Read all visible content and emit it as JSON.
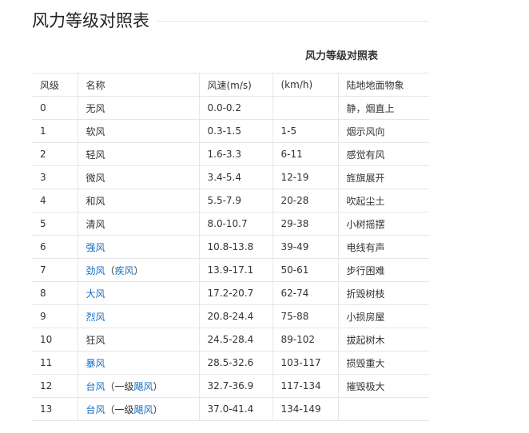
{
  "page_title": "风力等级对照表",
  "table": {
    "caption": "风力等级对照表",
    "headers": [
      "风级",
      "名称",
      "风速(m/s)",
      "(km/h)",
      "陆地地面物象"
    ],
    "rows": [
      {
        "level": "0",
        "name_parts": [
          {
            "text": "无风",
            "link": false
          }
        ],
        "ms": "0.0-0.2",
        "kmh": "",
        "land": "静，烟直上"
      },
      {
        "level": "1",
        "name_parts": [
          {
            "text": "软风",
            "link": false
          }
        ],
        "ms": "0.3-1.5",
        "kmh": "1-5",
        "land": "烟示风向"
      },
      {
        "level": "2",
        "name_parts": [
          {
            "text": "轻风",
            "link": false
          }
        ],
        "ms": "1.6-3.3",
        "kmh": "6-11",
        "land": "感觉有风"
      },
      {
        "level": "3",
        "name_parts": [
          {
            "text": "微风",
            "link": false
          }
        ],
        "ms": "3.4-5.4",
        "kmh": "12-19",
        "land": "旌旗展开"
      },
      {
        "level": "4",
        "name_parts": [
          {
            "text": "和风",
            "link": false
          }
        ],
        "ms": "5.5-7.9",
        "kmh": "20-28",
        "land": "吹起尘土"
      },
      {
        "level": "5",
        "name_parts": [
          {
            "text": "清风",
            "link": false
          }
        ],
        "ms": "8.0-10.7",
        "kmh": "29-38",
        "land": "小树摇摆"
      },
      {
        "level": "6",
        "name_parts": [
          {
            "text": "强风",
            "link": true
          }
        ],
        "ms": "10.8-13.8",
        "kmh": "39-49",
        "land": "电线有声"
      },
      {
        "level": "7",
        "name_parts": [
          {
            "text": "劲风",
            "link": true
          },
          {
            "text": "（",
            "link": false
          },
          {
            "text": "疾风",
            "link": true
          },
          {
            "text": "）",
            "link": false
          }
        ],
        "ms": "13.9-17.1",
        "kmh": "50-61",
        "land": "步行困难"
      },
      {
        "level": "8",
        "name_parts": [
          {
            "text": "大风",
            "link": true
          }
        ],
        "ms": "17.2-20.7",
        "kmh": "62-74",
        "land": "折毁树枝"
      },
      {
        "level": "9",
        "name_parts": [
          {
            "text": "烈风",
            "link": true
          }
        ],
        "ms": "20.8-24.4",
        "kmh": "75-88",
        "land": "小损房屋"
      },
      {
        "level": "10",
        "name_parts": [
          {
            "text": "狂风",
            "link": false
          }
        ],
        "ms": "24.5-28.4",
        "kmh": "89-102",
        "land": "拔起树木"
      },
      {
        "level": "11",
        "name_parts": [
          {
            "text": "暴风",
            "link": true
          }
        ],
        "ms": "28.5-32.6",
        "kmh": "103-117",
        "land": "损毁重大"
      },
      {
        "level": "12",
        "name_parts": [
          {
            "text": "台风",
            "link": true
          },
          {
            "text": "（一级",
            "link": false
          },
          {
            "text": "飓风",
            "link": true
          },
          {
            "text": "）",
            "link": false
          }
        ],
        "ms": "32.7-36.9",
        "kmh": "117-134",
        "land": "摧毁极大"
      },
      {
        "level": "13",
        "name_parts": [
          {
            "text": "台风",
            "link": true
          },
          {
            "text": "（一级",
            "link": false
          },
          {
            "text": "飓风",
            "link": true
          },
          {
            "text": "）",
            "link": false
          }
        ],
        "ms": "37.0-41.4",
        "kmh": "134-149",
        "land": ""
      }
    ]
  },
  "colors": {
    "link": "#136ec2",
    "text": "#333333",
    "border": "#e6e6e6"
  }
}
